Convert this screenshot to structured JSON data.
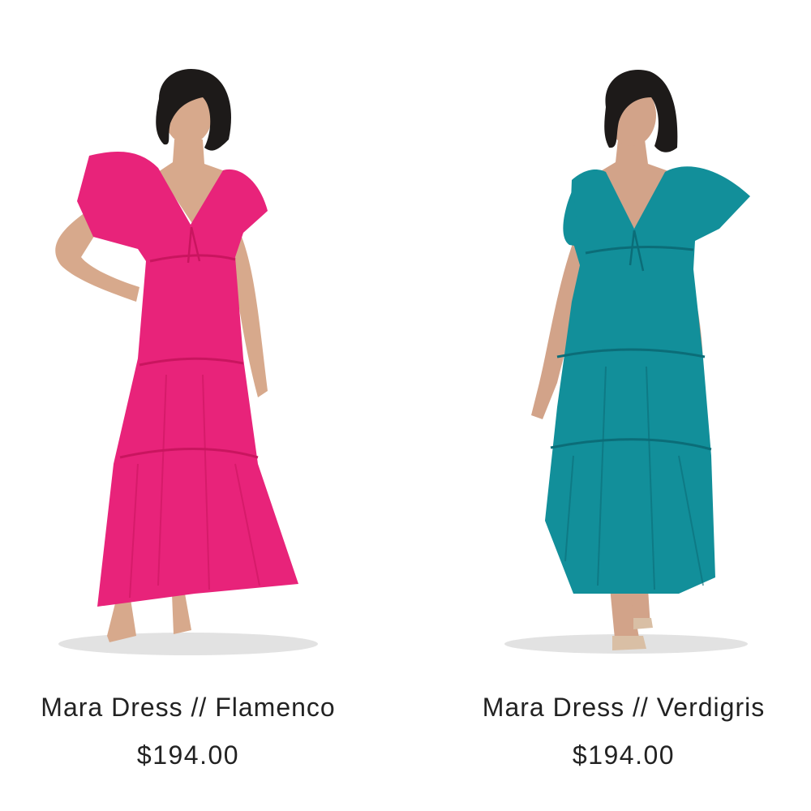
{
  "products": [
    {
      "name": "Mara Dress // Flamenco",
      "price": "$194.00",
      "color": "#e8237a",
      "shade": "#c9155f",
      "skin": "#d7a98c",
      "hair": "#1d1a19"
    },
    {
      "name": "Mara Dress // Verdigris",
      "price": "$194.00",
      "color": "#128f9a",
      "shade": "#0b6d78",
      "skin": "#d2a389",
      "hair": "#1d1a19"
    }
  ]
}
